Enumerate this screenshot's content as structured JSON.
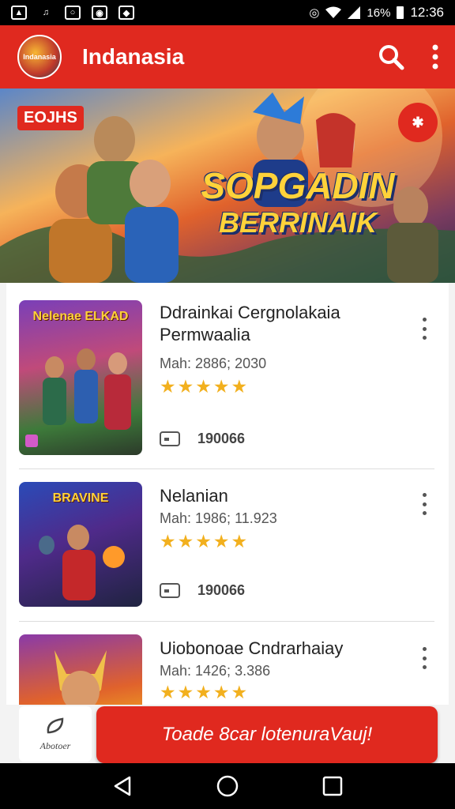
{
  "status_bar": {
    "battery": "16%",
    "time": "12:36"
  },
  "app_bar": {
    "title": "Indanasia",
    "logo_text": "Indanasia"
  },
  "hero": {
    "tag": "EOJHS",
    "title_line1": "SOPGADIN",
    "title_line2": "BERRINAIK"
  },
  "items": [
    {
      "thumb_text": "Nelenae ELKAD",
      "title": "Ddrainkai Cergnolakaia Permwaalia",
      "meta": "Mah: 2886; 2030",
      "stars": "★★★★★",
      "downloads": "190066"
    },
    {
      "thumb_text": "BRAVINE",
      "title": "Nelanian",
      "meta": "Mah: 1986; 11.923",
      "stars": "★★★★★",
      "downloads": "190066"
    },
    {
      "thumb_text": "",
      "title": "Uiobonoae Cndrarhaiay",
      "meta": "Mah: 1426; 3.386",
      "stars": "★★★★★",
      "downloads": ""
    }
  ],
  "bottom": {
    "about_label": "Abotoer",
    "cta_label": "Toade 8car lotenuraVauj!"
  },
  "colors": {
    "accent": "#e0291f",
    "star": "#f2b01e"
  }
}
